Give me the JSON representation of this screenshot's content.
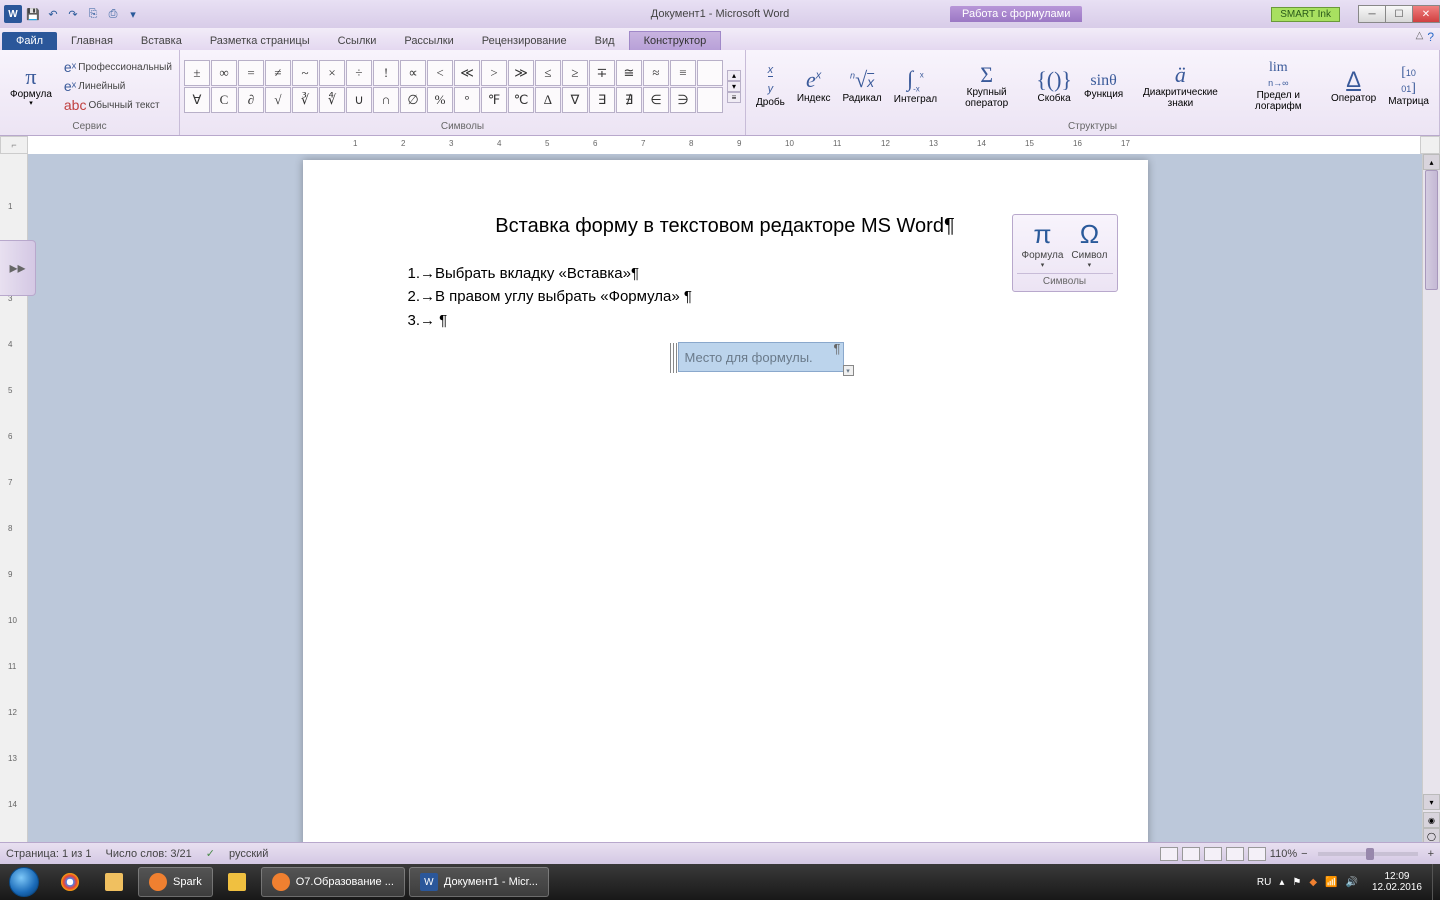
{
  "titlebar": {
    "doc_title": "Документ1 - Microsoft Word",
    "context_label": "Работа с формулами",
    "smart_ink": "SMART Ink"
  },
  "tabs": {
    "file": "Файл",
    "items": [
      "Главная",
      "Вставка",
      "Разметка страницы",
      "Ссылки",
      "Рассылки",
      "Рецензирование",
      "Вид"
    ],
    "context": "Конструктор"
  },
  "ribbon": {
    "service": {
      "formula": "Формула",
      "professional": "Профессиональный",
      "linear": "Линейный",
      "plain": "Обычный текст",
      "label": "Сервис"
    },
    "symbols": {
      "label": "Символы",
      "row1": [
        "±",
        "∞",
        "=",
        "≠",
        "~",
        "×",
        "÷",
        "!",
        "∝",
        "<",
        "≪",
        ">",
        "≫",
        "≤",
        "≥",
        "∓",
        "≅",
        "≈",
        "≡",
        ""
      ],
      "row2": [
        "∀",
        "C",
        "∂",
        "√",
        "∛",
        "∜",
        "∪",
        "∩",
        "∅",
        "%",
        "°",
        "℉",
        "℃",
        "∆",
        "∇",
        "∃",
        "∄",
        "∈",
        "∋",
        ""
      ]
    },
    "structures": {
      "label": "Структуры",
      "fraction": "Дробь",
      "index": "Индекс",
      "radical": "Радикал",
      "integral": "Интеграл",
      "large_op": "Крупный оператор",
      "bracket": "Скобка",
      "function": "Функция",
      "diacritic": "Диакритические знаки",
      "limit": "Предел и логарифм",
      "operator": "Оператор",
      "matrix": "Матрица"
    }
  },
  "document": {
    "title": "Вставка форму в текстовом редакторе  MS Word¶",
    "line1": "1.→Выбрать вкладку «Вставка»¶",
    "line2": "2.→В правом углу выбрать «Формула»  ¶",
    "line3": "3.→ ¶",
    "eq_placeholder": "Место для формулы."
  },
  "float": {
    "formula": "Формула",
    "symbol": "Символ",
    "label": "Символы"
  },
  "statusbar": {
    "page": "Страница: 1 из 1",
    "words": "Число слов: 3/21",
    "lang": "русский",
    "zoom": "110%"
  },
  "taskbar": {
    "items": [
      {
        "label": "Spark",
        "color": "#f08030"
      },
      {
        "label": "",
        "color": "#f0c040"
      },
      {
        "label": "О7.Образование ...",
        "color": "#f08030"
      },
      {
        "label": "Документ1 - Micr...",
        "color": "#2b579a"
      }
    ],
    "tray": {
      "lang": "RU",
      "time": "12:09",
      "date": "12.02.2016"
    }
  }
}
